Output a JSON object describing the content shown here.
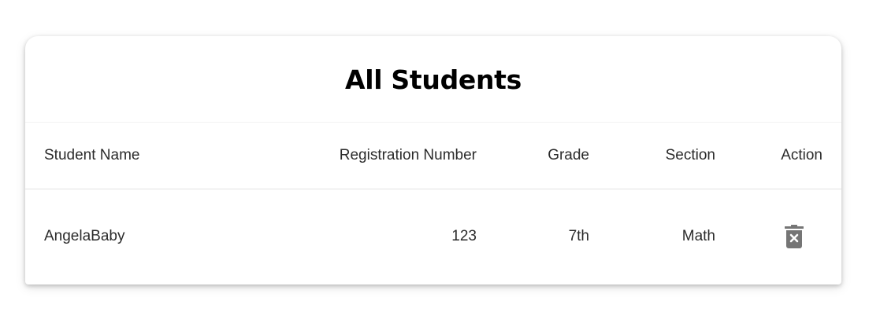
{
  "page": {
    "title": "All Students"
  },
  "table": {
    "columns": [
      "Student Name",
      "Registration Number",
      "Grade",
      "Section",
      "Action"
    ],
    "rows": [
      {
        "student_name": "AngelaBaby",
        "registration_number": "123",
        "grade": "7th",
        "section": "Math",
        "action_icon": "delete-forever-icon"
      }
    ]
  },
  "colors": {
    "icon": "#757575",
    "title": "#000000",
    "text": "#2b2b2b"
  }
}
